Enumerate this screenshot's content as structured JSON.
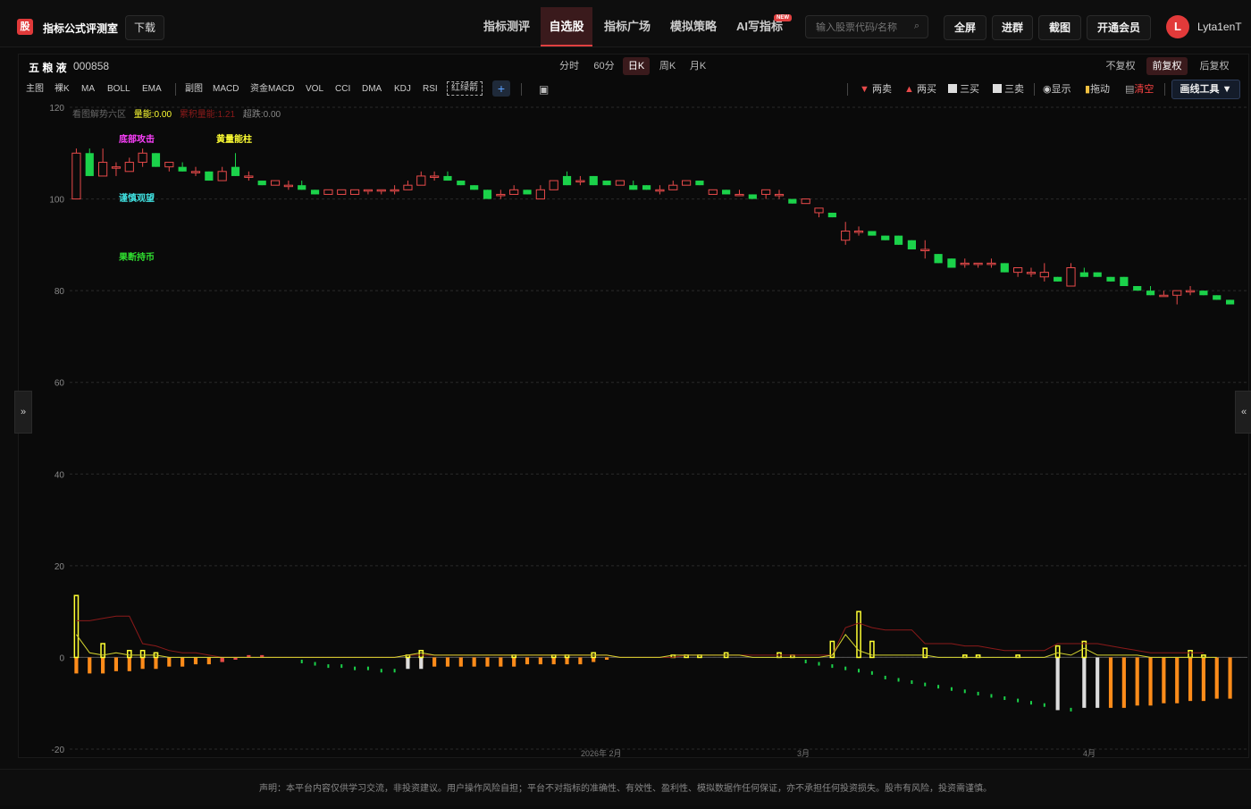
{
  "header": {
    "logo_char": "股",
    "app_title": "指标公式评测室",
    "download_label": "下载",
    "nav": [
      {
        "label": "指标测评",
        "active": false
      },
      {
        "label": "自选股",
        "active": true
      },
      {
        "label": "指标广场",
        "active": false
      },
      {
        "label": "模拟策略",
        "active": false
      },
      {
        "label": "AI写指标",
        "active": false
      }
    ],
    "new_badge": "NEW",
    "search_placeholder": "输入股票代码/名称",
    "buttons": {
      "fullscreen": "全屏",
      "join_group": "进群",
      "screenshot": "截图",
      "vip": "开通会员"
    },
    "avatar_letter": "L",
    "username": "Lyta1enT"
  },
  "stock": {
    "name": "五 粮 液",
    "code": "000858"
  },
  "periods": [
    {
      "label": "分时",
      "active": false
    },
    {
      "label": "60分",
      "active": false
    },
    {
      "label": "日K",
      "active": true
    },
    {
      "label": "周K",
      "active": false
    },
    {
      "label": "月K",
      "active": false
    }
  ],
  "adjust": [
    {
      "label": "不复权",
      "active": false
    },
    {
      "label": "前复权",
      "active": true
    },
    {
      "label": "后复权",
      "active": false
    }
  ],
  "indicators_main": [
    "主图",
    "裸K",
    "MA",
    "BOLL",
    "EMA"
  ],
  "indicators_sub": [
    "副图",
    "MACD",
    "资金MACD",
    "VOL",
    "CCI",
    "DMA",
    "KDJ",
    "RSI",
    "红绿箭"
  ],
  "add_label": "+",
  "draw_actions": {
    "two_sell": "两卖",
    "two_buy": "两买",
    "three_buy": "三买",
    "three_sell": "三卖",
    "show": "显示",
    "drag": "拖动",
    "clear": "清空",
    "draw_tools": "画线工具 ▼"
  },
  "colors": {
    "up": "#e84a4a",
    "down": "#1bd24a",
    "yellow": "#ffff33",
    "orange": "#ff8c1a",
    "accent": "#e04040"
  },
  "chart_header": {
    "title": "看图解势六区",
    "energy": "量能:0.00",
    "accum": "累积量能:1.21",
    "super": "超跌:0.00"
  },
  "annotations": {
    "bottom_attack": "底部攻击",
    "yellow_pillar": "黄量能柱",
    "caution": "谨慎观望",
    "decisive": "果断持币"
  },
  "side_tabs": {
    "left": "»",
    "right": "«"
  },
  "footer": "声明：本平台内容仅供学习交流，非投资建议。用户操作风险自担；平台不对指标的准确性、有效性、盈利性、模拟数据作任何保证，亦不承担任何投资损失。股市有风险，投资需谨慎。",
  "chart_data": {
    "type": "candlestick",
    "y_ticks": [
      120,
      100,
      80,
      60,
      40,
      20,
      0,
      -20
    ],
    "ylim": [
      -20,
      120
    ],
    "x_labels": [
      "2026年 2月",
      "3月",
      "4月"
    ],
    "candles": [
      {
        "o": 100,
        "h": 111,
        "l": 100,
        "c": 110
      },
      {
        "o": 110,
        "h": 111,
        "l": 105,
        "c": 105
      },
      {
        "o": 105,
        "h": 111,
        "l": 105,
        "c": 108
      },
      {
        "o": 107,
        "h": 108,
        "l": 105,
        "c": 107
      },
      {
        "o": 106,
        "h": 109,
        "l": 106,
        "c": 108
      },
      {
        "o": 108,
        "h": 111,
        "l": 107,
        "c": 110
      },
      {
        "o": 110,
        "h": 110,
        "l": 107,
        "c": 107
      },
      {
        "o": 107,
        "h": 108,
        "l": 106,
        "c": 108
      },
      {
        "o": 107,
        "h": 108,
        "l": 106,
        "c": 106
      },
      {
        "o": 106,
        "h": 107,
        "l": 105,
        "c": 106
      },
      {
        "o": 106,
        "h": 106,
        "l": 104,
        "c": 104
      },
      {
        "o": 104,
        "h": 107,
        "l": 104,
        "c": 106
      },
      {
        "o": 107,
        "h": 110,
        "l": 105,
        "c": 105
      },
      {
        "o": 105,
        "h": 106,
        "l": 104,
        "c": 105
      },
      {
        "o": 104,
        "h": 104,
        "l": 103,
        "c": 103
      },
      {
        "o": 103,
        "h": 104,
        "l": 103,
        "c": 104
      },
      {
        "o": 103,
        "h": 104,
        "l": 102,
        "c": 103
      },
      {
        "o": 103,
        "h": 104,
        "l": 102,
        "c": 102
      },
      {
        "o": 102,
        "h": 102,
        "l": 101,
        "c": 101
      },
      {
        "o": 101,
        "h": 102,
        "l": 101,
        "c": 102
      },
      {
        "o": 101,
        "h": 102,
        "l": 101,
        "c": 102
      },
      {
        "o": 101,
        "h": 102,
        "l": 101,
        "c": 102
      },
      {
        "o": 102,
        "h": 102,
        "l": 101,
        "c": 102
      },
      {
        "o": 102,
        "h": 102,
        "l": 101,
        "c": 102
      },
      {
        "o": 102,
        "h": 103,
        "l": 101,
        "c": 102
      },
      {
        "o": 102,
        "h": 104,
        "l": 102,
        "c": 103
      },
      {
        "o": 103,
        "h": 106,
        "l": 103,
        "c": 105
      },
      {
        "o": 105,
        "h": 106,
        "l": 104,
        "c": 105
      },
      {
        "o": 105,
        "h": 106,
        "l": 104,
        "c": 104
      },
      {
        "o": 104,
        "h": 104,
        "l": 103,
        "c": 103
      },
      {
        "o": 103,
        "h": 103,
        "l": 102,
        "c": 102
      },
      {
        "o": 102,
        "h": 102,
        "l": 100,
        "c": 100
      },
      {
        "o": 101,
        "h": 102,
        "l": 100,
        "c": 101
      },
      {
        "o": 101,
        "h": 103,
        "l": 101,
        "c": 102
      },
      {
        "o": 102,
        "h": 102,
        "l": 101,
        "c": 101
      },
      {
        "o": 100,
        "h": 103,
        "l": 100,
        "c": 102
      },
      {
        "o": 102,
        "h": 104,
        "l": 102,
        "c": 104
      },
      {
        "o": 105,
        "h": 106,
        "l": 103,
        "c": 103
      },
      {
        "o": 104,
        "h": 105,
        "l": 103,
        "c": 104
      },
      {
        "o": 105,
        "h": 105,
        "l": 103,
        "c": 103
      },
      {
        "o": 104,
        "h": 104,
        "l": 103,
        "c": 103
      },
      {
        "o": 103,
        "h": 104,
        "l": 103,
        "c": 104
      },
      {
        "o": 103,
        "h": 104,
        "l": 102,
        "c": 102
      },
      {
        "o": 103,
        "h": 103,
        "l": 102,
        "c": 102
      },
      {
        "o": 102,
        "h": 103,
        "l": 101,
        "c": 102
      },
      {
        "o": 102,
        "h": 104,
        "l": 102,
        "c": 103
      },
      {
        "o": 103,
        "h": 104,
        "l": 103,
        "c": 104
      },
      {
        "o": 104,
        "h": 104,
        "l": 103,
        "c": 103
      },
      {
        "o": 101,
        "h": 102,
        "l": 101,
        "c": 102
      },
      {
        "o": 102,
        "h": 102,
        "l": 101,
        "c": 101
      },
      {
        "o": 101,
        "h": 102,
        "l": 101,
        "c": 101
      },
      {
        "o": 101,
        "h": 101,
        "l": 100,
        "c": 100
      },
      {
        "o": 101,
        "h": 102,
        "l": 100,
        "c": 102
      },
      {
        "o": 101,
        "h": 102,
        "l": 100,
        "c": 101
      },
      {
        "o": 100,
        "h": 100,
        "l": 99,
        "c": 99
      },
      {
        "o": 99,
        "h": 100,
        "l": 99,
        "c": 100
      },
      {
        "o": 97,
        "h": 98,
        "l": 96,
        "c": 98
      },
      {
        "o": 97,
        "h": 97,
        "l": 96,
        "c": 96
      },
      {
        "o": 91,
        "h": 95,
        "l": 90,
        "c": 93
      },
      {
        "o": 93,
        "h": 94,
        "l": 92,
        "c": 93
      },
      {
        "o": 93,
        "h": 93,
        "l": 92,
        "c": 92
      },
      {
        "o": 92,
        "h": 92,
        "l": 91,
        "c": 91
      },
      {
        "o": 92,
        "h": 92,
        "l": 90,
        "c": 90
      },
      {
        "o": 91,
        "h": 91,
        "l": 89,
        "c": 89
      },
      {
        "o": 89,
        "h": 91,
        "l": 87,
        "c": 89
      },
      {
        "o": 88,
        "h": 88,
        "l": 86,
        "c": 86
      },
      {
        "o": 87,
        "h": 87,
        "l": 85,
        "c": 85
      },
      {
        "o": 86,
        "h": 87,
        "l": 85,
        "c": 86
      },
      {
        "o": 86,
        "h": 86,
        "l": 85,
        "c": 86
      },
      {
        "o": 86,
        "h": 87,
        "l": 85,
        "c": 86
      },
      {
        "o": 86,
        "h": 86,
        "l": 84,
        "c": 84
      },
      {
        "o": 84,
        "h": 85,
        "l": 83,
        "c": 85
      },
      {
        "o": 84,
        "h": 85,
        "l": 83,
        "c": 84
      },
      {
        "o": 83,
        "h": 86,
        "l": 82,
        "c": 84
      },
      {
        "o": 83,
        "h": 83,
        "l": 82,
        "c": 82
      },
      {
        "o": 81,
        "h": 86,
        "l": 81,
        "c": 85
      },
      {
        "o": 84,
        "h": 85,
        "l": 83,
        "c": 83
      },
      {
        "o": 84,
        "h": 84,
        "l": 83,
        "c": 83
      },
      {
        "o": 83,
        "h": 83,
        "l": 82,
        "c": 82
      },
      {
        "o": 83,
        "h": 83,
        "l": 81,
        "c": 81
      },
      {
        "o": 81,
        "h": 81,
        "l": 80,
        "c": 80
      },
      {
        "o": 80,
        "h": 81,
        "l": 79,
        "c": 79
      },
      {
        "o": 79,
        "h": 80,
        "l": 79,
        "c": 79
      },
      {
        "o": 79,
        "h": 80,
        "l": 77,
        "c": 80
      },
      {
        "o": 80,
        "h": 81,
        "l": 79,
        "c": 80
      },
      {
        "o": 80,
        "h": 80,
        "l": 79,
        "c": 79
      },
      {
        "o": 79,
        "h": 79,
        "l": 78,
        "c": 78
      },
      {
        "o": 78,
        "h": 78,
        "l": 77,
        "c": 77
      }
    ],
    "yellow_bars": [
      {
        "i": 0,
        "v": 13.5
      },
      {
        "i": 2,
        "v": 3
      },
      {
        "i": 4,
        "v": 1.5
      },
      {
        "i": 5,
        "v": 1.5
      },
      {
        "i": 6,
        "v": 1
      },
      {
        "i": 25,
        "v": 0.5
      },
      {
        "i": 26,
        "v": 1.5
      },
      {
        "i": 33,
        "v": 0.5
      },
      {
        "i": 36,
        "v": 0.5
      },
      {
        "i": 37,
        "v": 0.5
      },
      {
        "i": 39,
        "v": 1
      },
      {
        "i": 45,
        "v": 0.5
      },
      {
        "i": 46,
        "v": 0.5
      },
      {
        "i": 47,
        "v": 0.5
      },
      {
        "i": 49,
        "v": 1
      },
      {
        "i": 53,
        "v": 1
      },
      {
        "i": 54,
        "v": 0.5
      },
      {
        "i": 57,
        "v": 3.5
      },
      {
        "i": 59,
        "v": 10
      },
      {
        "i": 60,
        "v": 3.5
      },
      {
        "i": 64,
        "v": 2
      },
      {
        "i": 67,
        "v": 0.5
      },
      {
        "i": 68,
        "v": 0.5
      },
      {
        "i": 71,
        "v": 0.5
      },
      {
        "i": 74,
        "v": 2.5
      },
      {
        "i": 76,
        "v": 3.5
      },
      {
        "i": 84,
        "v": 1.5
      },
      {
        "i": 85,
        "v": 0.5
      }
    ],
    "orange_bars": [
      {
        "i": 0,
        "v": -3.5
      },
      {
        "i": 1,
        "v": -3.5
      },
      {
        "i": 2,
        "v": -3.5
      },
      {
        "i": 3,
        "v": -3
      },
      {
        "i": 4,
        "v": -3
      },
      {
        "i": 5,
        "v": -2.5
      },
      {
        "i": 6,
        "v": -2.5
      },
      {
        "i": 7,
        "v": -2
      },
      {
        "i": 8,
        "v": -2
      },
      {
        "i": 9,
        "v": -1.5
      },
      {
        "i": 10,
        "v": -1.5
      },
      {
        "i": 11,
        "v": -1
      },
      {
        "i": 25,
        "v": -2
      },
      {
        "i": 26,
        "v": -2
      },
      {
        "i": 27,
        "v": -2
      },
      {
        "i": 28,
        "v": -2
      },
      {
        "i": 29,
        "v": -2
      },
      {
        "i": 30,
        "v": -2
      },
      {
        "i": 31,
        "v": -2
      },
      {
        "i": 32,
        "v": -2
      },
      {
        "i": 33,
        "v": -2
      },
      {
        "i": 34,
        "v": -1.5
      },
      {
        "i": 35,
        "v": -1.5
      },
      {
        "i": 36,
        "v": -1.5
      },
      {
        "i": 37,
        "v": -1.5
      },
      {
        "i": 38,
        "v": -1.5
      },
      {
        "i": 39,
        "v": -1
      },
      {
        "i": 40,
        "v": -0.5
      },
      {
        "i": 78,
        "v": -11
      },
      {
        "i": 79,
        "v": -11
      },
      {
        "i": 80,
        "v": -10.5
      },
      {
        "i": 81,
        "v": -10.5
      },
      {
        "i": 82,
        "v": -10
      },
      {
        "i": 83,
        "v": -10
      },
      {
        "i": 84,
        "v": -9.5
      },
      {
        "i": 85,
        "v": -9.5
      },
      {
        "i": 86,
        "v": -9
      },
      {
        "i": 87,
        "v": -9
      }
    ],
    "white_bars": [
      {
        "i": 25,
        "v": -2.5
      },
      {
        "i": 26,
        "v": -2.5
      },
      {
        "i": 74,
        "v": -11.5
      },
      {
        "i": 76,
        "v": -11
      },
      {
        "i": 77,
        "v": -11
      }
    ],
    "red_small": [
      {
        "i": 11,
        "v": -1
      },
      {
        "i": 12,
        "v": -0.5
      },
      {
        "i": 13,
        "v": 0.5
      },
      {
        "i": 14,
        "v": 0.5
      }
    ],
    "green_dots": [
      {
        "i": 17,
        "v": -0.5
      },
      {
        "i": 18,
        "v": -1
      },
      {
        "i": 19,
        "v": -1.5
      },
      {
        "i": 20,
        "v": -1.5
      },
      {
        "i": 21,
        "v": -2
      },
      {
        "i": 22,
        "v": -2
      },
      {
        "i": 23,
        "v": -2.5
      },
      {
        "i": 24,
        "v": -2.5
      },
      {
        "i": 55,
        "v": -0.5
      },
      {
        "i": 56,
        "v": -1
      },
      {
        "i": 57,
        "v": -1.5
      },
      {
        "i": 58,
        "v": -2
      },
      {
        "i": 59,
        "v": -2.5
      },
      {
        "i": 60,
        "v": -3
      },
      {
        "i": 61,
        "v": -4
      },
      {
        "i": 62,
        "v": -4.5
      },
      {
        "i": 63,
        "v": -5
      },
      {
        "i": 64,
        "v": -5.5
      },
      {
        "i": 65,
        "v": -6
      },
      {
        "i": 66,
        "v": -6.5
      },
      {
        "i": 67,
        "v": -7
      },
      {
        "i": 68,
        "v": -7.5
      },
      {
        "i": 69,
        "v": -8
      },
      {
        "i": 70,
        "v": -8.5
      },
      {
        "i": 71,
        "v": -9
      },
      {
        "i": 72,
        "v": -9.5
      },
      {
        "i": 73,
        "v": -10
      },
      {
        "i": 75,
        "v": -11
      }
    ],
    "dark_red_line": [
      8,
      8,
      8.5,
      9,
      9,
      3,
      2.5,
      1.5,
      1,
      1,
      0.5,
      0,
      0,
      0,
      0,
      0,
      0,
      0,
      0,
      0,
      0,
      0,
      0,
      0,
      0,
      0.5,
      0.5,
      0.5,
      0.5,
      0.5,
      0.5,
      0.5,
      0.5,
      0.5,
      0.5,
      0.5,
      0.5,
      0.5,
      0.5,
      0.5,
      0.5,
      0,
      0,
      0,
      0,
      0,
      0.5,
      0.5,
      0.5,
      0.5,
      0.5,
      0.5,
      0.5,
      0.5,
      0.5,
      0.5,
      0.5,
      0.5,
      6.5,
      7.5,
      6.5,
      6,
      6,
      6,
      3,
      3,
      3,
      2.5,
      2.5,
      2,
      1.5,
      1.5,
      1.5,
      1.5,
      3,
      3,
      3,
      3,
      2.5,
      2,
      1.5,
      1,
      1,
      1,
      1,
      1
    ],
    "yellow_line": [
      5,
      1,
      0.5,
      1,
      0.5,
      0.5,
      0.5,
      0,
      0,
      0,
      0,
      0,
      0,
      0,
      0,
      0,
      0,
      0,
      0,
      0,
      0,
      0,
      0,
      0,
      0,
      0.5,
      1,
      0.5,
      0.5,
      0.5,
      0.5,
      0.5,
      0.5,
      0.5,
      0.5,
      0.5,
      0.5,
      0.5,
      0.5,
      0.5,
      0.5,
      0,
      0,
      0,
      0,
      0.5,
      0.5,
      0.5,
      0.5,
      0.5,
      0.5,
      0,
      0,
      0,
      0,
      0,
      0,
      0.5,
      5,
      1.5,
      0.5,
      0.5,
      0.5,
      0.5,
      0.5,
      0,
      0,
      0,
      0,
      0,
      0,
      0,
      0,
      0,
      1,
      0.5,
      2,
      0.5,
      0.5,
      0.5,
      0.5,
      0,
      0,
      0,
      0,
      0,
      0
    ]
  }
}
